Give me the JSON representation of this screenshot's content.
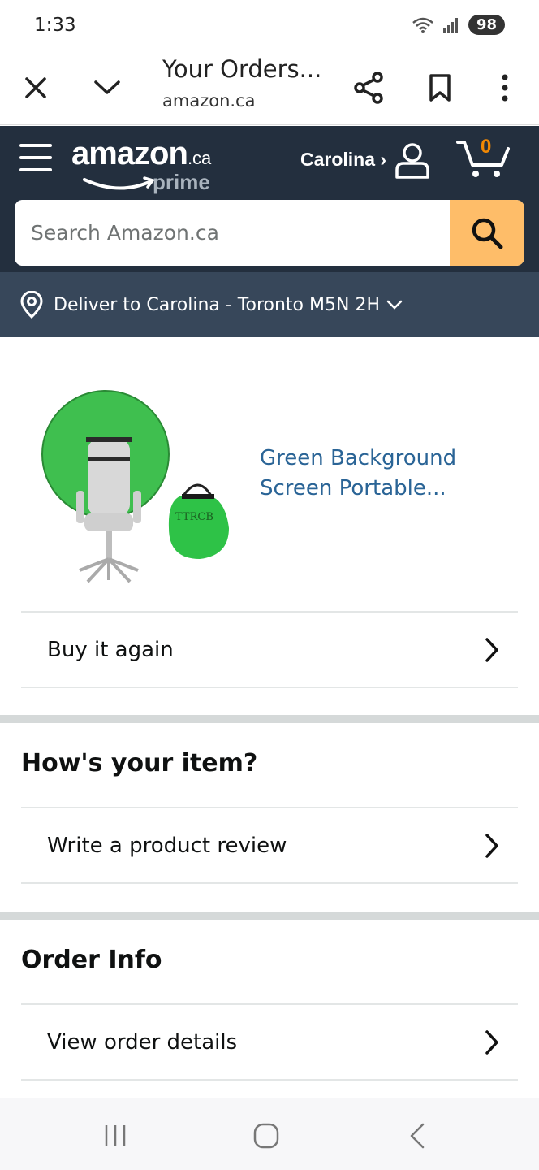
{
  "status_bar": {
    "time": "1:33",
    "battery": "98"
  },
  "browser": {
    "title": "Your Orders...",
    "url": "amazon.ca"
  },
  "header": {
    "logo_main": "amazon",
    "logo_tld": ".ca",
    "logo_prime": "prime",
    "account_name": "Carolina ›",
    "cart_count": "0"
  },
  "search": {
    "placeholder": "Search Amazon.ca"
  },
  "deliver": {
    "text": "Deliver to Carolina - Toronto M5N 2H"
  },
  "product": {
    "title_line1": "Green Background",
    "title_line2": "Screen Portable...",
    "bag_label": "TTRCB"
  },
  "actions": {
    "buy_again": "Buy it again"
  },
  "sections": {
    "hows_item": {
      "heading": "How's your item?",
      "write_review": "Write a product review"
    },
    "order_info": {
      "heading": "Order Info",
      "view_details": "View order details"
    }
  },
  "colors": {
    "header_bg": "#232f3e",
    "deliver_bg": "#37475a",
    "search_button": "#febd69",
    "link": "#2a6496",
    "cart_count": "#f08804"
  }
}
